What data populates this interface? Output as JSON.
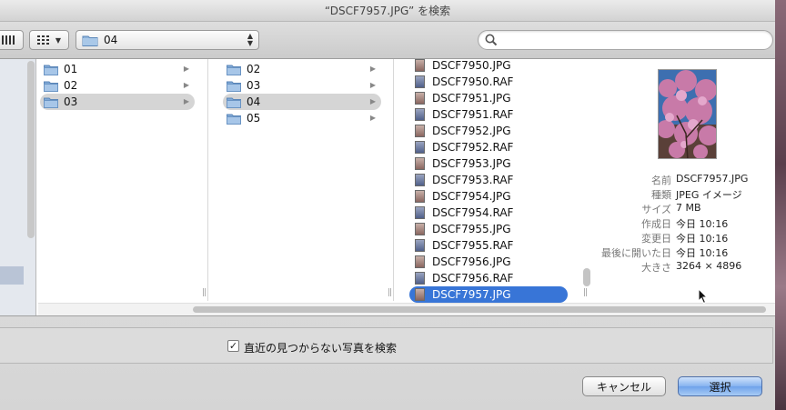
{
  "window": {
    "title": "“DSCF7957.JPG” を検索"
  },
  "toolbar": {
    "view_button_icon": "column-view-icon",
    "arrange_button_icon": "grid-arrange-icon",
    "path_popup_label": "04",
    "search_placeholder": "",
    "search_value": ""
  },
  "columns": [
    {
      "items": [
        {
          "label": "01",
          "type": "folder",
          "selected": false
        },
        {
          "label": "02",
          "type": "folder",
          "selected": false
        },
        {
          "label": "03",
          "type": "folder",
          "selected": true
        }
      ]
    },
    {
      "items": [
        {
          "label": "02",
          "type": "folder",
          "selected": false
        },
        {
          "label": "03",
          "type": "folder",
          "selected": false
        },
        {
          "label": "04",
          "type": "folder",
          "selected": true
        },
        {
          "label": "05",
          "type": "folder",
          "selected": false
        }
      ]
    },
    {
      "items": [
        {
          "label": "DSCF7950.JPG",
          "type": "jpg"
        },
        {
          "label": "DSCF7950.RAF",
          "type": "raf"
        },
        {
          "label": "DSCF7951.JPG",
          "type": "jpg"
        },
        {
          "label": "DSCF7951.RAF",
          "type": "raf"
        },
        {
          "label": "DSCF7952.JPG",
          "type": "jpg"
        },
        {
          "label": "DSCF7952.RAF",
          "type": "raf"
        },
        {
          "label": "DSCF7953.JPG",
          "type": "jpg"
        },
        {
          "label": "DSCF7953.RAF",
          "type": "raf"
        },
        {
          "label": "DSCF7954.JPG",
          "type": "jpg"
        },
        {
          "label": "DSCF7954.RAF",
          "type": "raf"
        },
        {
          "label": "DSCF7955.JPG",
          "type": "jpg"
        },
        {
          "label": "DSCF7955.RAF",
          "type": "raf"
        },
        {
          "label": "DSCF7956.JPG",
          "type": "jpg"
        },
        {
          "label": "DSCF7956.RAF",
          "type": "raf"
        },
        {
          "label": "DSCF7957.JPG",
          "type": "jpg",
          "selected": true
        }
      ]
    }
  ],
  "preview": {
    "info": [
      {
        "key": "名前",
        "value": "DSCF7957.JPG"
      },
      {
        "key": "種類",
        "value": "JPEG イメージ"
      },
      {
        "key": "サイズ",
        "value": "7 MB"
      },
      {
        "key": "作成日",
        "value": "今日 10:16"
      },
      {
        "key": "変更日",
        "value": "今日 10:16"
      },
      {
        "key": "最後に開いた日",
        "value": "今日 10:16"
      },
      {
        "key": "大きさ",
        "value": "3264 × 4896"
      }
    ]
  },
  "options": {
    "checkbox_label": "直近の見つからない写真を検索",
    "checkbox_checked": true,
    "check_glyph": "✓"
  },
  "buttons": {
    "cancel": "キャンセル",
    "choose": "選択"
  },
  "colors": {
    "selection_blue": "#3875d7",
    "selection_grey": "#d5d5d5",
    "primary_button": "#86b3ef"
  }
}
